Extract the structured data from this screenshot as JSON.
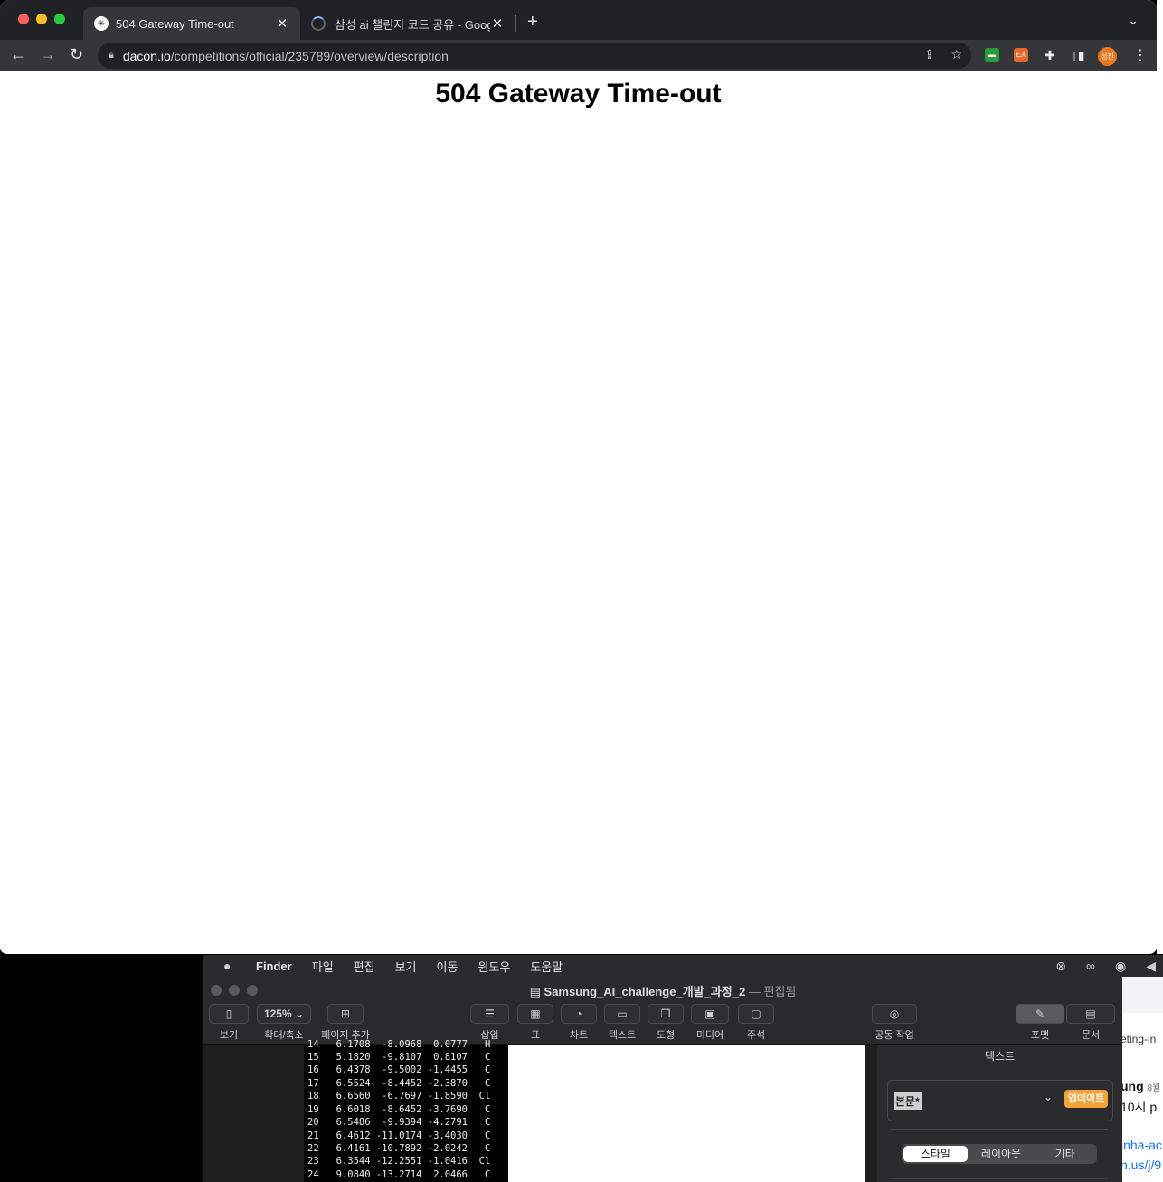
{
  "browser": {
    "tabs": [
      {
        "title": "504 Gateway Time-out",
        "active": true
      },
      {
        "title": "삼성 ai 챌린지 코드 공유 - Google",
        "active": false
      }
    ],
    "url_host": "dacon.io",
    "url_path": "/competitions/official/235789/overview/description",
    "avatar_text": "성진"
  },
  "page": {
    "heading": "504 Gateway Time-out"
  },
  "menubar": {
    "app": "Finder",
    "items": [
      "파일",
      "편집",
      "보기",
      "이동",
      "윈도우",
      "도움말"
    ]
  },
  "pages_app": {
    "doc_name": "Samsung_AI_challenge_개발_과정_2",
    "doc_state": "편집됨",
    "toolbar": {
      "view": "보기",
      "zoom_value": "125%",
      "zoom_label": "확대/축소",
      "add_page": "페이지 추가",
      "insert": "삽입",
      "table": "표",
      "chart": "차트",
      "text": "텍스트",
      "shape": "도형",
      "media": "미디어",
      "comment": "주석",
      "collaborate": "공동 작업",
      "format": "포맷",
      "document": "문서"
    },
    "terminal_rows": [
      "14   6.1708  -8.0968  0.0777   H",
      "15   5.1820  -9.8107  0.8107   C",
      "16   6.4378  -9.5002 -1.4455   C",
      "17   6.5524  -8.4452 -2.3870   C",
      "18   6.6560  -6.7697 -1.8590  Cl",
      "19   6.6018  -8.6452 -3.7690   C",
      "20   6.5486  -9.9394 -4.2791   C",
      "21   6.4612 -11.0174 -3.4030   C",
      "22   6.4161 -10.7892 -2.0242   C",
      "23   6.3544 -12.2551 -1.0416  Cl",
      "24   9.0840 -13.2714  2.0466   C"
    ],
    "sidebar": {
      "header": "텍스트",
      "paragraph_style": "본문*",
      "update_button": "업데이트",
      "tabs": [
        "스타일",
        "레이아웃",
        "기타"
      ]
    }
  },
  "bg_window": {
    "line1": "eting-in",
    "line2": "ung",
    "line2_suffix": "8월",
    "line3": "10시 p",
    "line4": "inha-ac",
    "line5": "n.us/j/9"
  }
}
